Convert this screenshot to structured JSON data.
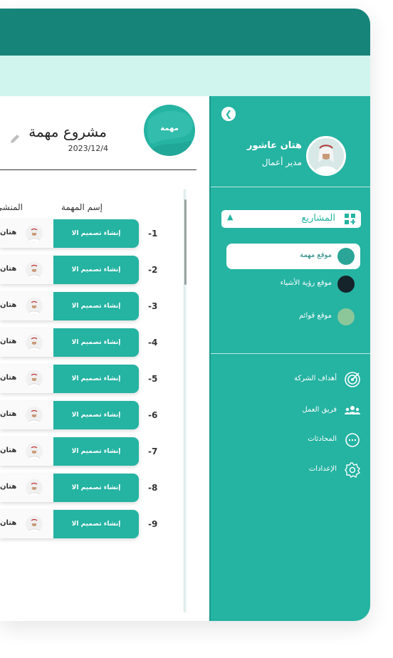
{
  "user": {
    "name": "هتان عاشور",
    "role": "مدير أعمال"
  },
  "sidebar": {
    "projects_label": "المشاريع",
    "projects": [
      {
        "label": "موقع مهمة",
        "active": true,
        "thumb_color": "#2aa597"
      },
      {
        "label": "موقع رؤية الأشياء",
        "active": false,
        "thumb_color": "#15232a"
      },
      {
        "label": "موقع قوائم",
        "active": false,
        "thumb_color": "#8cc79a"
      }
    ],
    "nav": [
      {
        "label": "أهداف الشركة",
        "icon": "target-icon"
      },
      {
        "label": "فريق العمل",
        "icon": "team-icon"
      },
      {
        "label": "المحادثات",
        "icon": "chat-icon"
      },
      {
        "label": "الإعدادات",
        "icon": "settings-icon"
      }
    ]
  },
  "project": {
    "badge": "مهمة",
    "title": "مشروع مهمة",
    "date": "2023/12/4"
  },
  "table": {
    "headers": {
      "task": "إسم المهمة",
      "owner": "المنشئ"
    },
    "rows": [
      {
        "num": "-1",
        "task": "إنشاء تصميم الا",
        "owner": "هتان"
      },
      {
        "num": "-2",
        "task": "إنشاء تصميم الا",
        "owner": "هتان"
      },
      {
        "num": "-3",
        "task": "إنشاء تصميم الا",
        "owner": "هتان"
      },
      {
        "num": "-4",
        "task": "إنشاء تصميم الا",
        "owner": "هتان"
      },
      {
        "num": "-5",
        "task": "إنشاء تصميم الا",
        "owner": "هتان"
      },
      {
        "num": "-6",
        "task": "إنشاء تصميم الا",
        "owner": "هتان"
      },
      {
        "num": "-7",
        "task": "إنشاء تصميم الا",
        "owner": "هتان"
      },
      {
        "num": "-8",
        "task": "إنشاء تصميم الا",
        "owner": "هتان"
      },
      {
        "num": "-9",
        "task": "إنشاء تصميم الا",
        "owner": "هتان"
      }
    ]
  },
  "colors": {
    "accent": "#25b3a2",
    "dark_accent": "#17847a",
    "light_bar": "#cff5ee"
  }
}
